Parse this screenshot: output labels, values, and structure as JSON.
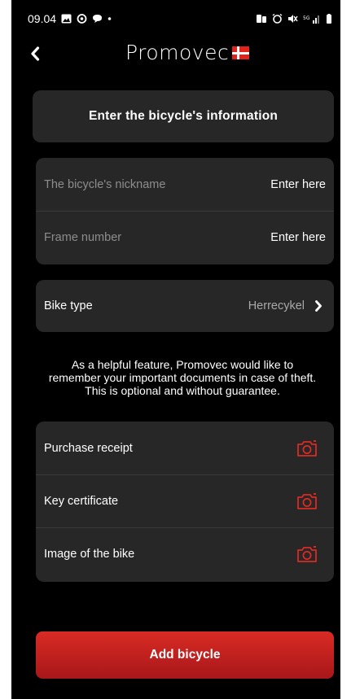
{
  "status_bar": {
    "time": "09.04"
  },
  "header": {
    "brand": "Promovec",
    "back_icon": "chevron-left-icon",
    "flag": "danish-flag"
  },
  "title": "Enter the bicycle's information",
  "fields": [
    {
      "label": "The bicycle's nickname",
      "value": "Enter here"
    },
    {
      "label": "Frame number",
      "value": "Enter here"
    }
  ],
  "bike_type": {
    "label": "Bike type",
    "value": "Herrecykel",
    "icon": "chevron-right-icon"
  },
  "help_text": "As a helpful feature, Promovec would like to remember your important documents in case of theft. This is optional and without guarantee.",
  "documents": [
    {
      "label": "Purchase receipt",
      "icon": "camera-icon"
    },
    {
      "label": "Key certificate",
      "icon": "camera-icon"
    },
    {
      "label": "Image of the bike",
      "icon": "camera-icon"
    }
  ],
  "add_button": {
    "label": "Add bicycle"
  },
  "colors": {
    "background": "#000000",
    "card": "#272727",
    "accent": "#d92b24",
    "muted_text": "#8d8d8d"
  }
}
